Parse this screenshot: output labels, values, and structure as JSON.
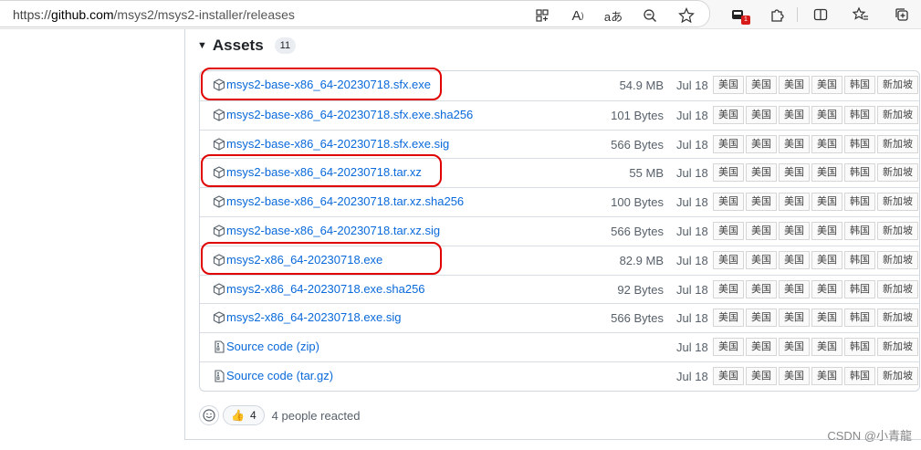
{
  "browser": {
    "url_host_prefix": "https://",
    "url_host": "github.com",
    "url_path": "/msys2/msys2-installer/releases",
    "icons": [
      "grid-icon",
      "read-aloud-icon",
      "translate-icon",
      "zoom-icon",
      "favorite-icon",
      "extension-badge-icon",
      "puzzle-icon",
      "split-screen-icon",
      "favorites-list-icon",
      "collections-icon"
    ],
    "translate_glyph": "aあ",
    "read_aloud_glyph": "A",
    "badge_count": "1"
  },
  "assets": {
    "title": "Assets",
    "count": "11",
    "mirrors": [
      "美国",
      "美国",
      "美国",
      "美国",
      "韩国",
      "新加坡"
    ],
    "items": [
      {
        "name": "msys2-base-x86_64-20230718.sfx.exe",
        "size": "54.9 MB",
        "date": "Jul 18",
        "icon": "package-icon",
        "highlighted": true
      },
      {
        "name": "msys2-base-x86_64-20230718.sfx.exe.sha256",
        "size": "101 Bytes",
        "date": "Jul 18",
        "icon": "package-icon",
        "highlighted": false
      },
      {
        "name": "msys2-base-x86_64-20230718.sfx.exe.sig",
        "size": "566 Bytes",
        "date": "Jul 18",
        "icon": "package-icon",
        "highlighted": false
      },
      {
        "name": "msys2-base-x86_64-20230718.tar.xz",
        "size": "55 MB",
        "date": "Jul 18",
        "icon": "package-icon",
        "highlighted": true
      },
      {
        "name": "msys2-base-x86_64-20230718.tar.xz.sha256",
        "size": "100 Bytes",
        "date": "Jul 18",
        "icon": "package-icon",
        "highlighted": false
      },
      {
        "name": "msys2-base-x86_64-20230718.tar.xz.sig",
        "size": "566 Bytes",
        "date": "Jul 18",
        "icon": "package-icon",
        "highlighted": false
      },
      {
        "name": "msys2-x86_64-20230718.exe",
        "size": "82.9 MB",
        "date": "Jul 18",
        "icon": "package-icon",
        "highlighted": true
      },
      {
        "name": "msys2-x86_64-20230718.exe.sha256",
        "size": "92 Bytes",
        "date": "Jul 18",
        "icon": "package-icon",
        "highlighted": false
      },
      {
        "name": "msys2-x86_64-20230718.exe.sig",
        "size": "566 Bytes",
        "date": "Jul 18",
        "icon": "package-icon",
        "highlighted": false
      },
      {
        "name": "Source code",
        "suffix": "(zip)",
        "size": "",
        "date": "Jul 18",
        "icon": "file-zip-icon",
        "highlighted": false
      },
      {
        "name": "Source code",
        "suffix": "(tar.gz)",
        "size": "",
        "date": "Jul 18",
        "icon": "file-zip-icon",
        "highlighted": false
      }
    ]
  },
  "reactions": {
    "thumbs_count": "4",
    "summary": "4 people reacted"
  },
  "watermark": "CSDN @小青龍",
  "colors": {
    "link": "#0969da",
    "highlight_ring": "#e00000",
    "muted_text": "#57606a"
  }
}
